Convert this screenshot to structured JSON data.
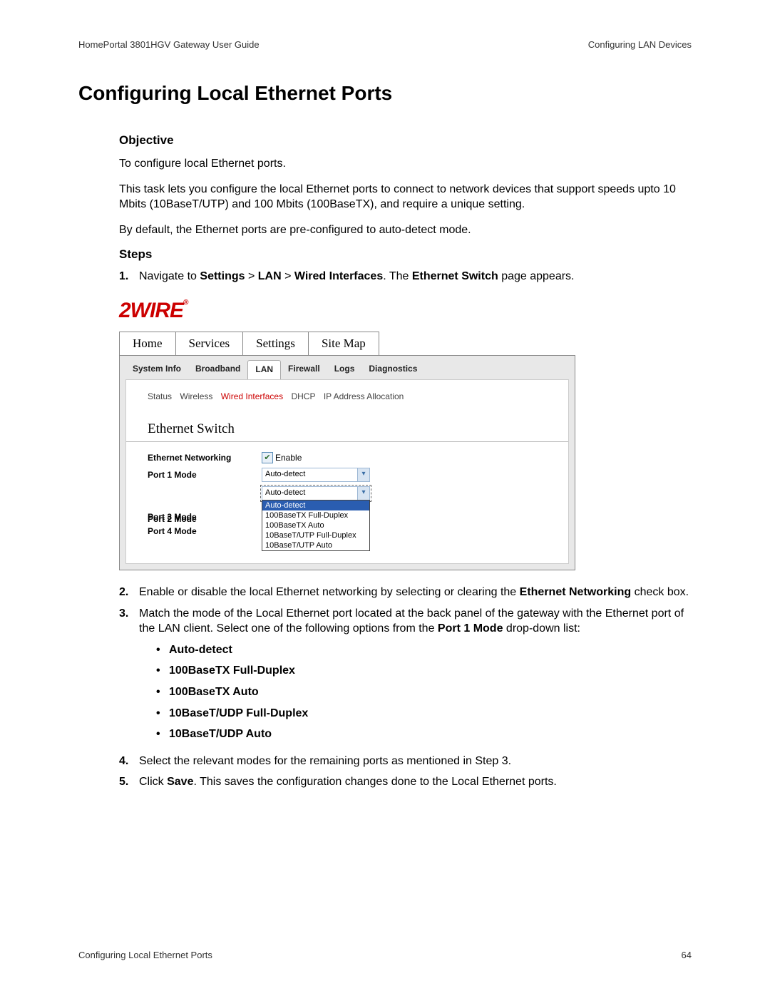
{
  "header": {
    "left": "HomePortal 3801HGV Gateway User Guide",
    "right": "Configuring LAN Devices"
  },
  "title": "Configuring Local Ethernet Ports",
  "objective": {
    "heading": "Objective",
    "line1": "To configure local Ethernet ports.",
    "line2": "This task lets you configure the local Ethernet ports to connect to network devices that support speeds upto 10 Mbits (10BaseT/UTP) and 100 Mbits (100BaseTX), and require a unique setting.",
    "line3": "By default, the Ethernet ports are pre-configured to auto-detect mode."
  },
  "steps_label": "Steps",
  "step1": {
    "num": "1.",
    "pre": "Navigate to ",
    "b1": "Settings",
    "sep1": " > ",
    "b2": "LAN",
    "sep2": " > ",
    "b3": "Wired Interfaces",
    "mid": ". The ",
    "b4": "Ethernet Switch",
    "post": " page appears."
  },
  "shot": {
    "logo": "2WIRE",
    "logo_reg": "®",
    "tabs": {
      "home": "Home",
      "services": "Services",
      "settings": "Settings",
      "sitemap": "Site Map"
    },
    "subtabs": {
      "sysinfo": "System Info",
      "broadband": "Broadband",
      "lan": "LAN",
      "firewall": "Firewall",
      "logs": "Logs",
      "diag": "Diagnostics"
    },
    "tertiary": {
      "status": "Status",
      "wireless": "Wireless",
      "wired": "Wired Interfaces",
      "dhcp": "DHCP",
      "ip": "IP Address Allocation"
    },
    "section": "Ethernet Switch",
    "eth_net_label": "Ethernet Networking",
    "enable_label": "Enable",
    "port1_label": "Port 1 Mode",
    "port2_label": "Port 2 Mode",
    "port3_label": "Port 3 Mode",
    "port4_label": "Port 4 Mode",
    "dd_value": "Auto-detect",
    "options": {
      "o1": "Auto-detect",
      "o2": "100BaseTX Full-Duplex",
      "o3": "100BaseTX Auto",
      "o4": "10BaseT/UTP Full-Duplex",
      "o5": "10BaseT/UTP Auto"
    }
  },
  "step2": {
    "num": "2.",
    "pre": "Enable or disable the local Ethernet networking by selecting or clearing the ",
    "b1": "Ethernet Networking",
    "post": " check box."
  },
  "step3": {
    "num": "3.",
    "pre": "Match the mode of the Local Ethernet port located at the back panel of the gateway with the Ethernet port of the LAN client. Select one of the following options from the ",
    "b1": "Port 1 Mode",
    "post": " drop-down list:",
    "opt1": "Auto-detect",
    "opt2": "100BaseTX Full-Duplex",
    "opt3": "100BaseTX Auto",
    "opt4": "10BaseT/UDP Full-Duplex",
    "opt5": "10BaseT/UDP Auto"
  },
  "step4": {
    "num": "4.",
    "txt": "Select the relevant modes for the remaining ports as mentioned in Step 3."
  },
  "step5": {
    "num": "5.",
    "pre": "Click ",
    "b1": "Save",
    "post": ". This saves the configuration changes done to the Local Ethernet ports."
  },
  "footer": {
    "left": "Configuring Local Ethernet Ports",
    "right": "64"
  }
}
